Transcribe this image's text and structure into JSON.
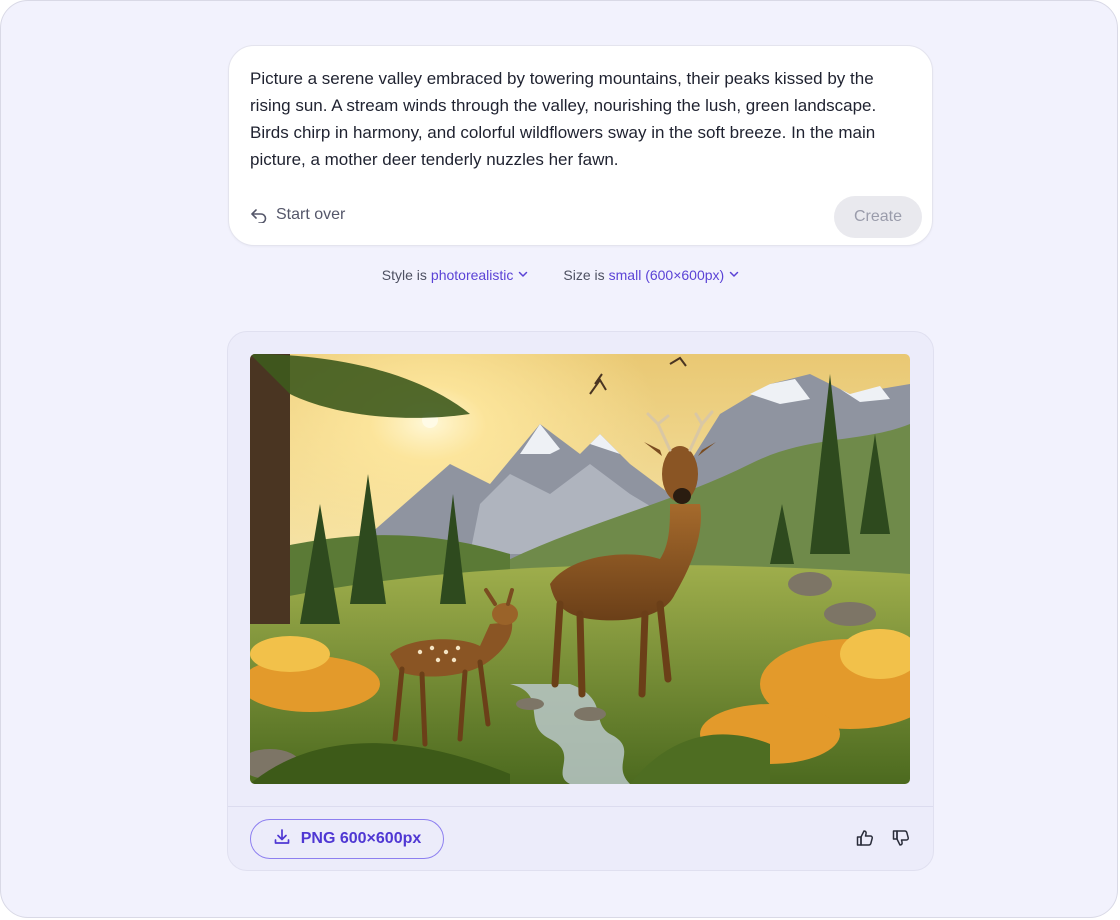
{
  "prompt": {
    "text": "Picture a serene valley embraced by towering mountains, their peaks kissed by the rising sun. A stream winds through the valley, nourishing the lush, green landscape. Birds chirp in harmony, and colorful wildflowers sway in the soft breeze. In the main picture, a mother deer tenderly nuzzles her fawn.",
    "start_over_label": "Start over",
    "create_label": "Create"
  },
  "options": {
    "style_prefix": "Style is",
    "style_value": "photorealistic",
    "size_prefix": "Size is",
    "size_value": "small (600×600px)"
  },
  "result": {
    "download_label": "PNG 600×600px",
    "icons": [
      "undo-icon",
      "chevron-down-icon",
      "download-icon",
      "thumbs-up-icon",
      "thumbs-down-icon"
    ]
  },
  "colors": {
    "accent": "#5b43d6",
    "background": "#f2f2fd",
    "card": "#ffffff"
  }
}
